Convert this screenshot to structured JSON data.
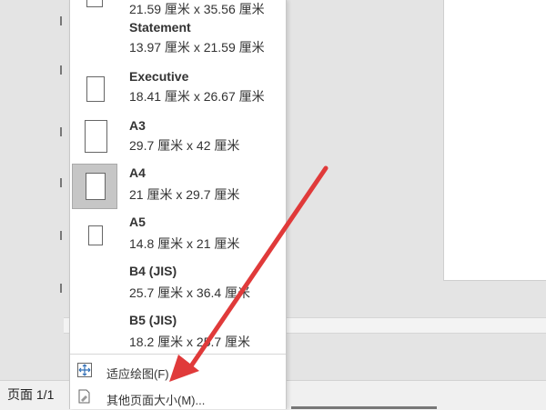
{
  "status_bar": {
    "page_label": "页面 1/1"
  },
  "page_sizes": [
    {
      "name": "",
      "dims": "21.59 厘米 x 35.56 厘米",
      "selected": false
    },
    {
      "name": "Statement",
      "dims": "13.97 厘米 x 21.59 厘米",
      "selected": false
    },
    {
      "name": "Executive",
      "dims": "18.41 厘米 x 26.67 厘米",
      "selected": false
    },
    {
      "name": "A3",
      "dims": "29.7 厘米 x 42 厘米",
      "selected": false
    },
    {
      "name": "A4",
      "dims": "21 厘米 x 29.7 厘米",
      "selected": true
    },
    {
      "name": "A5",
      "dims": "14.8 厘米 x 21 厘米",
      "selected": false
    },
    {
      "name": "B4 (JIS)",
      "dims": "25.7 厘米 x 36.4 厘米",
      "selected": false
    },
    {
      "name": "B5 (JIS)",
      "dims": "18.2 厘米 x 25.7 厘米",
      "selected": false
    }
  ],
  "commands": [
    {
      "label": "适应绘图(F)",
      "icon": "fit-to-drawing-icon"
    },
    {
      "label": "其他页面大小(M)...",
      "icon": "page-setup-icon"
    }
  ],
  "colors": {
    "annotation_arrow": "#e03a3a",
    "selected_bg": "#c6c6c6"
  }
}
